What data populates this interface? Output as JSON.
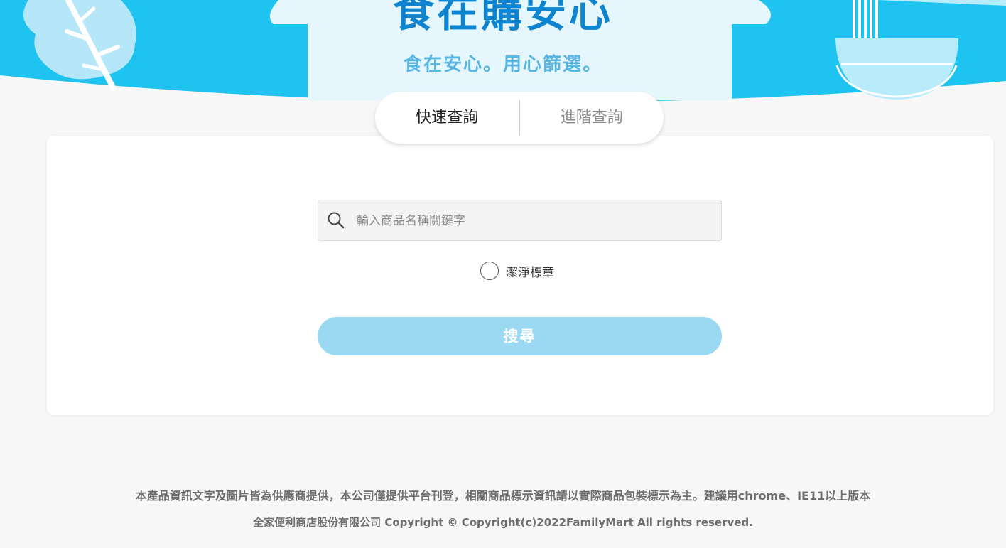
{
  "header": {
    "title": "食在購安心",
    "subtitle": "食在安心。用心篩選。"
  },
  "tabs": [
    {
      "label": "快速查詢",
      "active": true
    },
    {
      "label": "進階查詢",
      "active": false
    }
  ],
  "search": {
    "placeholder": "輸入商品名稱關鍵字",
    "value": ""
  },
  "filter": {
    "clean_label": "潔淨標章",
    "checked": false
  },
  "search_button": "搜尋",
  "footer": {
    "disclaimer": "本產品資訊文字及圖片皆為供應商提供，本公司僅提供平台刊登，相關商品標示資訊請以實際商品包裝標示為主。建議用chrome、IE11以上版本",
    "copyright": "全家便利商店股份有限公司 Copyright © Copyright(c)2022FamilyMart All rights reserved."
  },
  "colors": {
    "banner_blue": "#1ec4ef",
    "house_fill": "#e6f6fd",
    "title_blue": "#0e83cf",
    "subtitle_blue": "#57b6e2",
    "button_blue": "#9bd9f3"
  },
  "icons": {
    "search": "search-icon",
    "left_decoration": "vegetable-leaf-icon",
    "right_decoration": "noodle-bowl-icon"
  }
}
